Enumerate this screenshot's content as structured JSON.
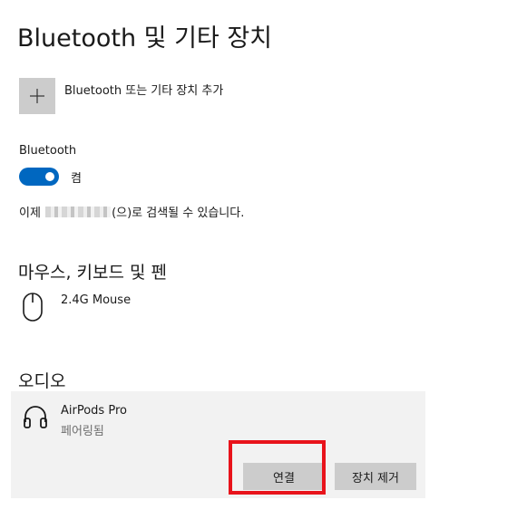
{
  "page": {
    "title": "Bluetooth 및 기타 장치"
  },
  "add_device": {
    "label": "Bluetooth 또는 기타 장치 추가",
    "icon": "plus-icon"
  },
  "bluetooth": {
    "label": "Bluetooth",
    "toggle_state": "켬",
    "toggle_on": true,
    "accent_color": "#0067c0",
    "discoverable_prefix": "이제 ",
    "discoverable_suffix": "(으)로 검색될 수 있습니다."
  },
  "sections": {
    "input": {
      "title": "마우스, 키보드 및 펜",
      "devices": [
        {
          "name": "2.4G Mouse",
          "icon": "mouse-icon"
        }
      ]
    },
    "audio": {
      "title": "오디오",
      "devices": [
        {
          "name": "AirPods Pro",
          "status": "페어링됨",
          "icon": "headphones-icon",
          "connect_label": "연결",
          "remove_label": "장치 제거"
        }
      ]
    }
  },
  "annotation": {
    "highlight_color": "#e8131b"
  }
}
